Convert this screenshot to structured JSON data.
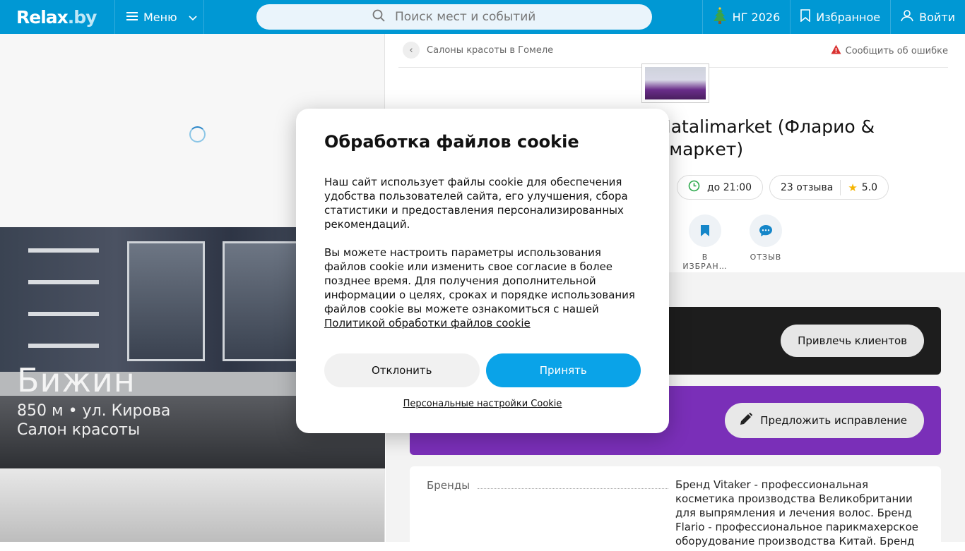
{
  "header": {
    "logo": "Relax.by",
    "menu_label": "Меню",
    "search_placeholder": "Поиск мест и событий",
    "ny_label": "НГ 2026",
    "favorites_label": "Избранное",
    "login_label": "Войти"
  },
  "left": {
    "photo_title": "Бижин",
    "photo_distance": "850 м • ул. Кирова",
    "photo_category": "Салон красоты"
  },
  "right": {
    "breadcrumb": "Салоны красоты в Гомеле",
    "report_error": "Сообщить об ошибке",
    "title_line1": "Natalimarket (Фларио &",
    "title_line2": "имаркет)",
    "hours": "до 21:00",
    "reviews": "23 отзыва",
    "rating": "5.0",
    "action_favorite": "В ИЗБРАН…",
    "action_review": "ОТЗЫВ",
    "attract_clients": "Привлечь клиентов",
    "suggest_fix": "Предложить исправление",
    "brands_label": "Бренды",
    "brands_text": "Бренд Vitaker - профессиональная косметика производства Великобритании для выпрямления и лечения волос. Бренд Flario - профессиональное парикмахерское оборудование производства Китай. Бренд"
  },
  "cookie": {
    "title": "Обработка файлов cookie",
    "p1": "Наш сайт использует файлы cookie для обеспечения удобства пользователей сайта, его улучшения, сбора статистики и предоставления персонализированных рекомендаций.",
    "p2": "Вы можете настроить параметры использования файлов cookie или изменить свое согласие в более позднее время. Для получения дополнительной информации о целях, сроках и порядке использования файлов cookie вы можете ознакомиться с нашей",
    "policy_link": "Политикой обработки файлов cookie",
    "decline": "Отклонить",
    "accept": "Принять",
    "settings_link": "Персональные настройки Cookie"
  }
}
